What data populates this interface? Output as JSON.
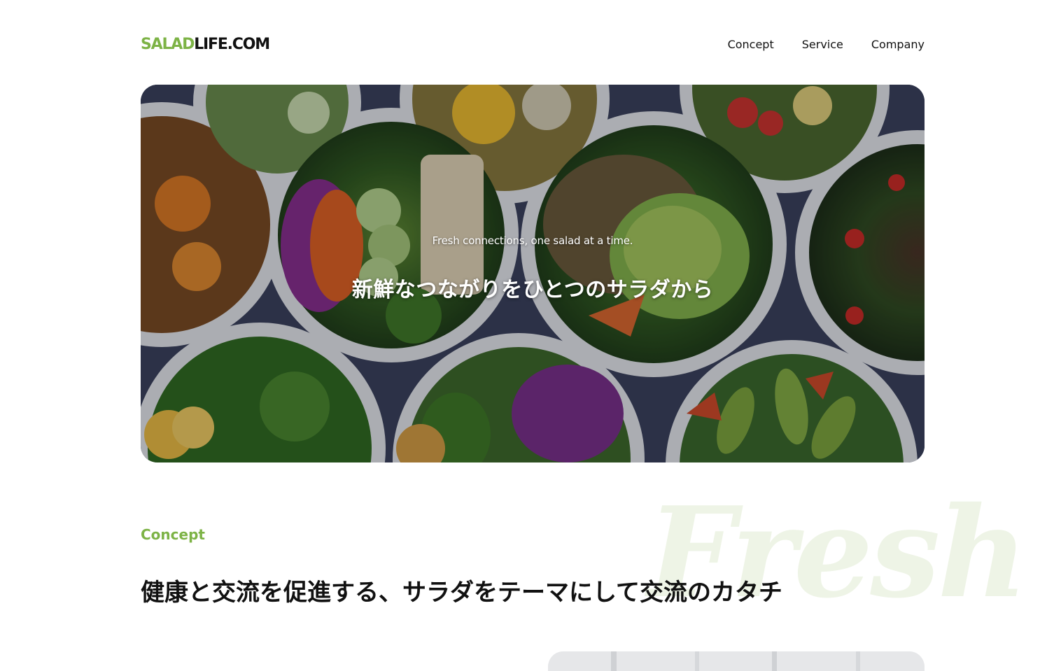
{
  "site": {
    "logo_part1": "SALAD",
    "logo_part2": "LIFE.COM",
    "brand_color": "#7db346"
  },
  "nav": {
    "items": [
      {
        "label": "Concept"
      },
      {
        "label": "Service"
      },
      {
        "label": "Company"
      }
    ]
  },
  "hero": {
    "subtitle": "Fresh connections, one salad at a time.",
    "title": "新鮮なつながりをひとつのサラダから"
  },
  "concept": {
    "label": "Concept",
    "watermark": "Fresh",
    "heading": "健康と交流を促進する、サラダをテーマにして交流のカタチ"
  }
}
